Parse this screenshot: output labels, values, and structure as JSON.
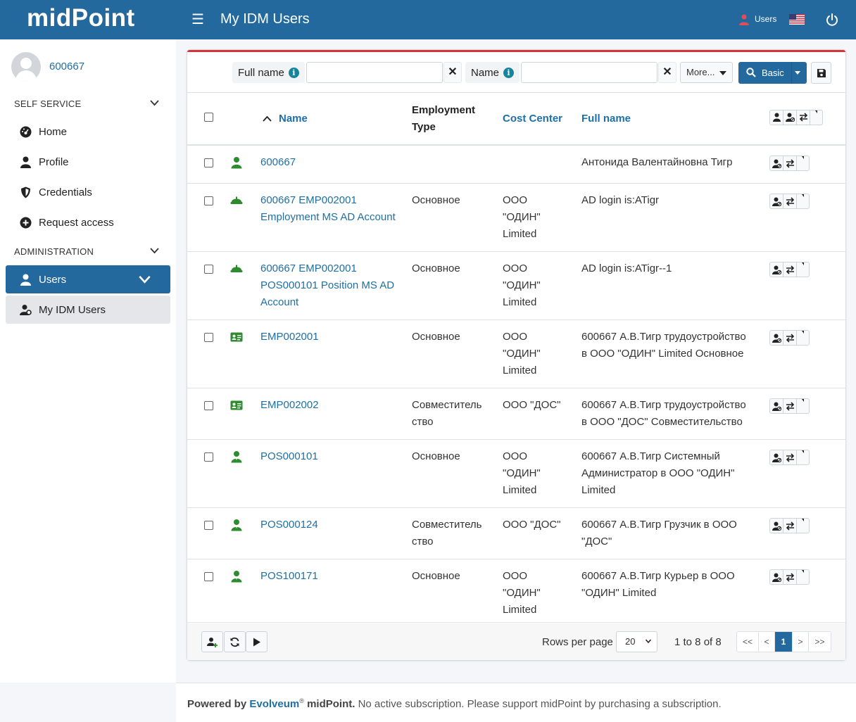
{
  "brand": {
    "logo_text": "midPoint"
  },
  "header": {
    "title": "My IDM Users",
    "user_label": "Users"
  },
  "sidebar": {
    "username": "600667",
    "sections": [
      {
        "label": "SELF SERVICE"
      },
      {
        "label": "ADMINISTRATION"
      }
    ],
    "items": [
      {
        "label": "Home",
        "icon": "gauge-icon"
      },
      {
        "label": "Profile",
        "icon": "user-icon"
      },
      {
        "label": "Credentials",
        "icon": "shield-icon"
      },
      {
        "label": "Request access",
        "icon": "plus-circle-icon"
      },
      {
        "label": "Users",
        "icon": "user-icon",
        "active": true
      },
      {
        "label": "My IDM Users",
        "icon": "user-gear-icon"
      }
    ]
  },
  "search": {
    "fields": [
      {
        "label": "Full name",
        "value": ""
      },
      {
        "label": "Name",
        "value": ""
      }
    ],
    "more_label": "More...",
    "basic_label": "Basic"
  },
  "table": {
    "columns": {
      "name": "Name",
      "employment_type_1": "Employment",
      "employment_type_2": "Type",
      "cost_center": "Cost Center",
      "full_name": "Full name"
    },
    "rows": [
      {
        "icon": "person",
        "name": [
          "600667"
        ],
        "emp": [],
        "cost": [],
        "full": [
          "Антонида Валентайновна Тигр"
        ]
      },
      {
        "icon": "helmet",
        "name": [
          "600667 EMP002001",
          "Employment MS AD Account"
        ],
        "emp": [
          "Основное"
        ],
        "cost": [
          "ООО",
          "\"ОДИН\"",
          "Limited"
        ],
        "full": [
          "AD login is:ATigr"
        ]
      },
      {
        "icon": "helmet",
        "name": [
          "600667 EMP002001",
          "POS000101 Position MS AD",
          "Account"
        ],
        "emp": [
          "Основное"
        ],
        "cost": [
          "ООО",
          "\"ОДИН\"",
          "Limited"
        ],
        "full": [
          "AD login is:ATigr--1"
        ]
      },
      {
        "icon": "idcard",
        "name": [
          "EMP002001"
        ],
        "emp": [
          "Основное"
        ],
        "cost": [
          "ООО",
          "\"ОДИН\"",
          "Limited"
        ],
        "full": [
          "600667 А.В.Тигр трудоустройство",
          "в ООО \"ОДИН\" Limited Основное"
        ]
      },
      {
        "icon": "idcard",
        "name": [
          "EMP002002"
        ],
        "emp": [
          "Совместитель",
          "ство"
        ],
        "cost": [
          "ООО \"ДОС\""
        ],
        "full": [
          "600667 А.В.Тигр трудоустройство",
          "в ООО \"ДОС\" Совместительство"
        ]
      },
      {
        "icon": "badgeperson",
        "name": [
          "POS000101"
        ],
        "emp": [
          "Основное"
        ],
        "cost": [
          "ООО",
          "\"ОДИН\"",
          "Limited"
        ],
        "full": [
          "600667 А.В.Тигр Системный",
          "Администратор в ООО \"ОДИН\"",
          "Limited"
        ]
      },
      {
        "icon": "badgeperson",
        "name": [
          "POS000124"
        ],
        "emp": [
          "Совместитель",
          "ство"
        ],
        "cost": [
          "ООО \"ДОС\""
        ],
        "full": [
          "600667 А.В.Тигр Грузчик в ООО",
          "\"ДОС\""
        ]
      },
      {
        "icon": "badgeperson",
        "name": [
          "POS100171"
        ],
        "emp": [
          "Основное"
        ],
        "cost": [
          "ООО",
          "\"ОДИН\"",
          "Limited"
        ],
        "full": [
          "600667 А.В.Тигр Курьер в ООО",
          "\"ОДИН\" Limited"
        ]
      }
    ]
  },
  "paging": {
    "rows_per_page_label": "Rows per page",
    "rows_per_page": "20",
    "count_text": "1 to 8 of 8",
    "first": "<<",
    "prev": "<",
    "current": "1",
    "next": ">",
    "last": ">>"
  },
  "footer": {
    "powered_by": "Powered by",
    "company": "Evolveum",
    "reg": "®",
    "product": "midPoint.",
    "note": "No active subscription. Please support midPoint by purchasing a subscription."
  },
  "colors": {
    "header": "#23699e",
    "accent_red": "#d4343b",
    "icon_green": "#2e8b2e",
    "link": "#1d6fa5"
  }
}
